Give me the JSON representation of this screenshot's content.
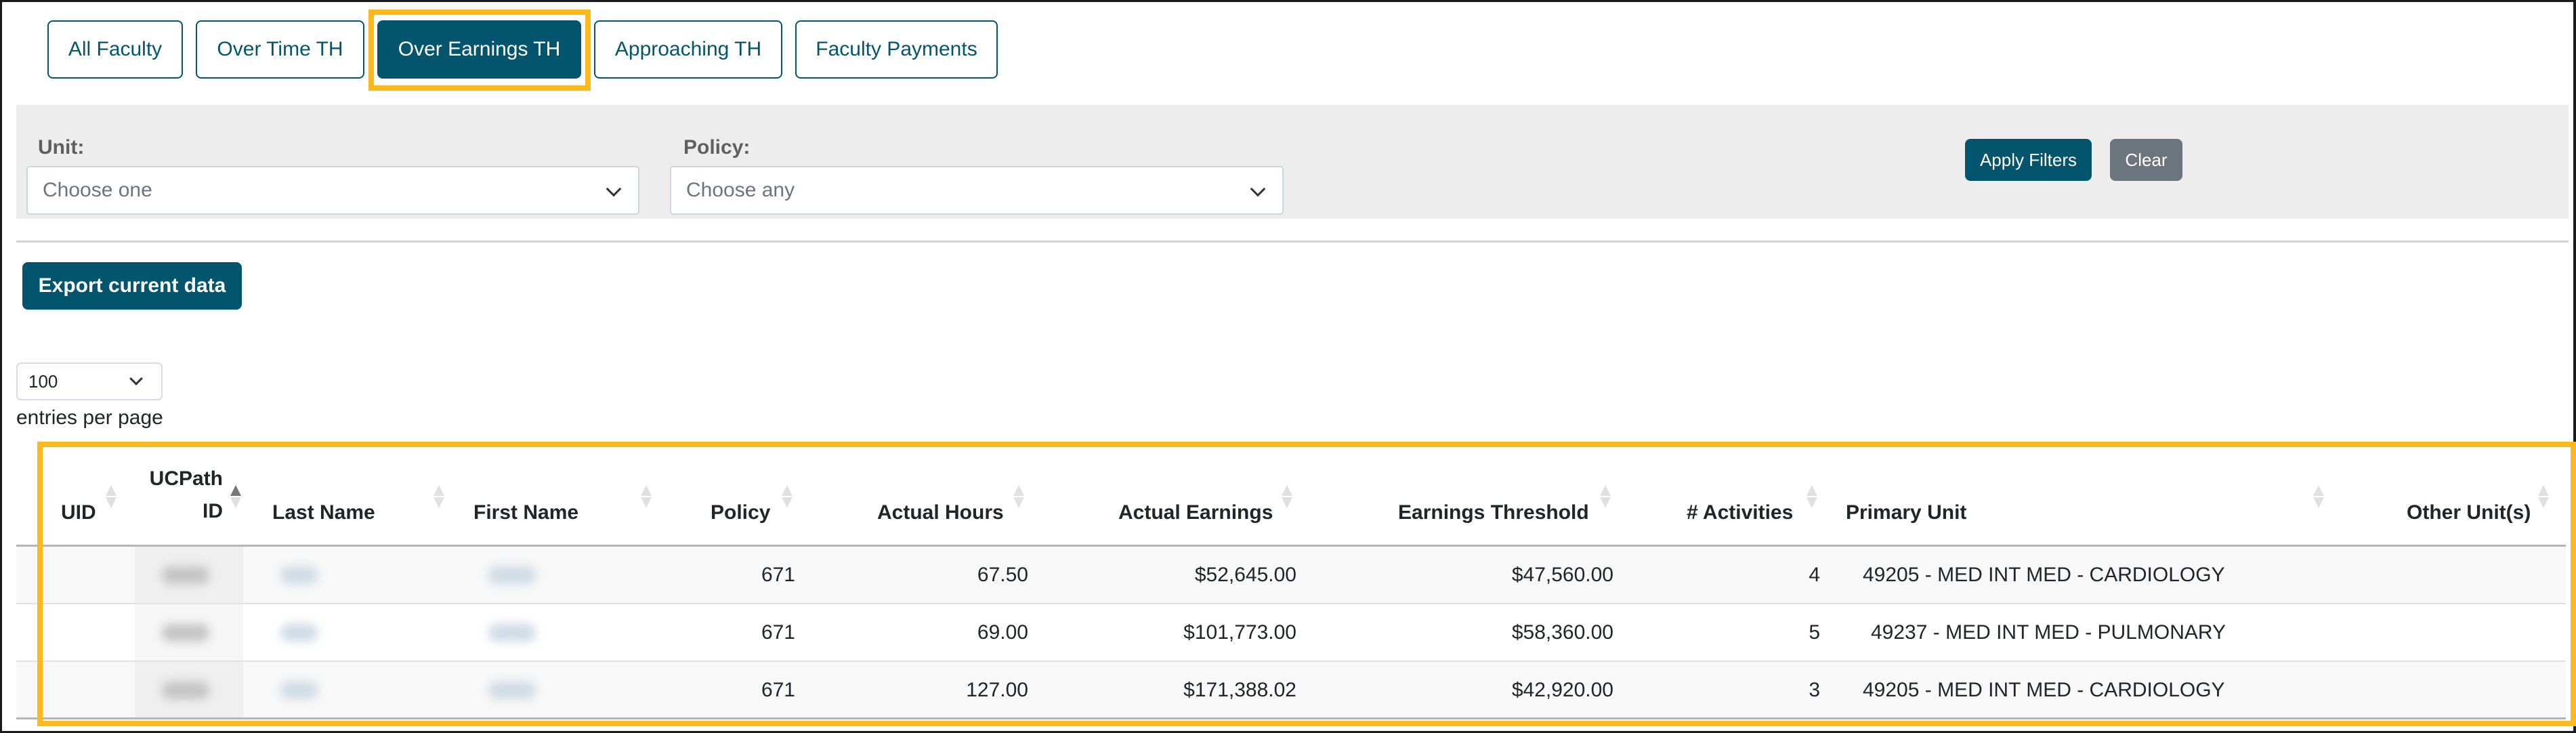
{
  "tabs": [
    {
      "label": "All Faculty",
      "active": false
    },
    {
      "label": "Over Time TH",
      "active": false
    },
    {
      "label": "Over Earnings TH",
      "active": true
    },
    {
      "label": "Approaching TH",
      "active": false
    },
    {
      "label": "Faculty Payments",
      "active": false
    }
  ],
  "filters": {
    "unit_label": "Unit:",
    "unit_placeholder": "Choose one",
    "policy_label": "Policy:",
    "policy_placeholder": "Choose any",
    "apply_label": "Apply Filters",
    "clear_label": "Clear"
  },
  "export_label": "Export current data",
  "entries": {
    "value": "100",
    "label": "entries per page"
  },
  "table": {
    "sorted_column": "UCPath ID",
    "sort_direction": "ascending",
    "columns": [
      {
        "line1": "",
        "line2": "UID"
      },
      {
        "line1": "UCPath",
        "line2": "ID"
      },
      {
        "line1": "",
        "line2": "Last Name"
      },
      {
        "line1": "",
        "line2": "First Name"
      },
      {
        "line1": "",
        "line2": "Policy"
      },
      {
        "line1": "",
        "line2": "Actual Hours"
      },
      {
        "line1": "",
        "line2": "Actual Earnings"
      },
      {
        "line1": "",
        "line2": "Earnings Threshold"
      },
      {
        "line1": "",
        "line2": "# Activities"
      },
      {
        "line1": "",
        "line2": "Primary Unit"
      },
      {
        "line1": "",
        "line2": "Other Unit(s)"
      }
    ],
    "rows": [
      {
        "uid": "",
        "ucpath_id": "[redacted]",
        "last_name": "[redacted]",
        "first_name": "[redacted]",
        "policy": "671",
        "actual_hours": "67.50",
        "actual_earnings": "$52,645.00",
        "earnings_threshold": "$47,560.00",
        "activities": "4",
        "primary_unit": "49205 - MED INT MED - CARDIOLOGY",
        "other_units": ""
      },
      {
        "uid": "",
        "ucpath_id": "[redacted]",
        "last_name": "[redacted]",
        "first_name": "[redacted]",
        "policy": "671",
        "actual_hours": "69.00",
        "actual_earnings": "$101,773.00",
        "earnings_threshold": "$58,360.00",
        "activities": "5",
        "primary_unit": "49237 - MED INT MED - PULMONARY",
        "other_units": ""
      },
      {
        "uid": "",
        "ucpath_id": "[redacted]",
        "last_name": "[redacted]",
        "first_name": "[redacted]",
        "policy": "671",
        "actual_hours": "127.00",
        "actual_earnings": "$171,388.02",
        "earnings_threshold": "$42,920.00",
        "activities": "3",
        "primary_unit": "49205 - MED INT MED - CARDIOLOGY",
        "other_units": ""
      }
    ]
  },
  "colors": {
    "primary": "#03556d",
    "secondary": "#6c757d",
    "highlight": "#fdb81e",
    "panel": "#ededed"
  }
}
